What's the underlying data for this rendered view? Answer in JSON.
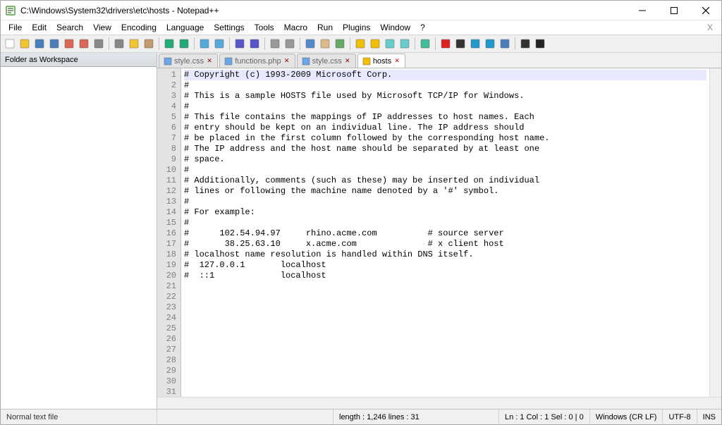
{
  "titlebar": {
    "title": "C:\\Windows\\System32\\drivers\\etc\\hosts - Notepad++"
  },
  "menubar": {
    "items": [
      "File",
      "Edit",
      "Search",
      "View",
      "Encoding",
      "Language",
      "Settings",
      "Tools",
      "Macro",
      "Run",
      "Plugins",
      "Window",
      "?"
    ],
    "right": "X"
  },
  "sidebar": {
    "title": "Folder as Workspace"
  },
  "tabs": [
    {
      "label": "style.css",
      "active": false,
      "icon": "file-blue"
    },
    {
      "label": "functions.php",
      "active": false,
      "icon": "file-blue"
    },
    {
      "label": "style.css",
      "active": false,
      "icon": "file-blue"
    },
    {
      "label": "hosts",
      "active": true,
      "icon": "file-yellow"
    }
  ],
  "editor": {
    "num_lines": 31,
    "current_line": 1,
    "lines": [
      "# Copyright (c) 1993-2009 Microsoft Corp.",
      "#",
      "# This is a sample HOSTS file used by Microsoft TCP/IP for Windows.",
      "#",
      "# This file contains the mappings of IP addresses to host names. Each",
      "# entry should be kept on an individual line. The IP address should",
      "# be placed in the first column followed by the corresponding host name.",
      "# The IP address and the host name should be separated by at least one",
      "# space.",
      "#",
      "# Additionally, comments (such as these) may be inserted on individual",
      "# lines or following the machine name denoted by a '#' symbol.",
      "#",
      "# For example:",
      "#",
      "#      102.54.94.97     rhino.acme.com          # source server",
      "#       38.25.63.10     x.acme.com              # x client host",
      "# localhost name resolution is handled within DNS itself.",
      "#  127.0.0.1       localhost",
      "#  ::1             localhost",
      "",
      "",
      "",
      "",
      "",
      "",
      "",
      "",
      "",
      "",
      ""
    ]
  },
  "status": {
    "file_type": "Normal text file",
    "length_label": "length : 1,246    lines : 31",
    "position": "Ln : 1    Col : 1    Sel : 0 | 0",
    "line_ending": "Windows (CR LF)",
    "encoding": "UTF-8",
    "mode": "INS"
  },
  "toolbar_icons": [
    "new-file-icon",
    "open-file-icon",
    "save-icon",
    "save-all-icon",
    "close-icon",
    "close-all-icon",
    "print-icon",
    "sep",
    "cut-icon",
    "copy-icon",
    "paste-icon",
    "sep",
    "undo-icon",
    "redo-icon",
    "sep",
    "find-icon",
    "replace-icon",
    "sep",
    "zoom-in-icon",
    "zoom-out-icon",
    "sep",
    "sync-v-icon",
    "sync-h-icon",
    "sep",
    "word-wrap-icon",
    "all-chars-icon",
    "indent-guide-icon",
    "sep",
    "lang-icon",
    "folder-icon",
    "doc-map-icon",
    "func-list-icon",
    "sep",
    "monitor-icon",
    "sep",
    "record-icon",
    "stop-icon",
    "play-icon",
    "play-multi-icon",
    "save-macro-icon",
    "sep",
    "spell-check-icon",
    "toggle-dark-icon"
  ]
}
